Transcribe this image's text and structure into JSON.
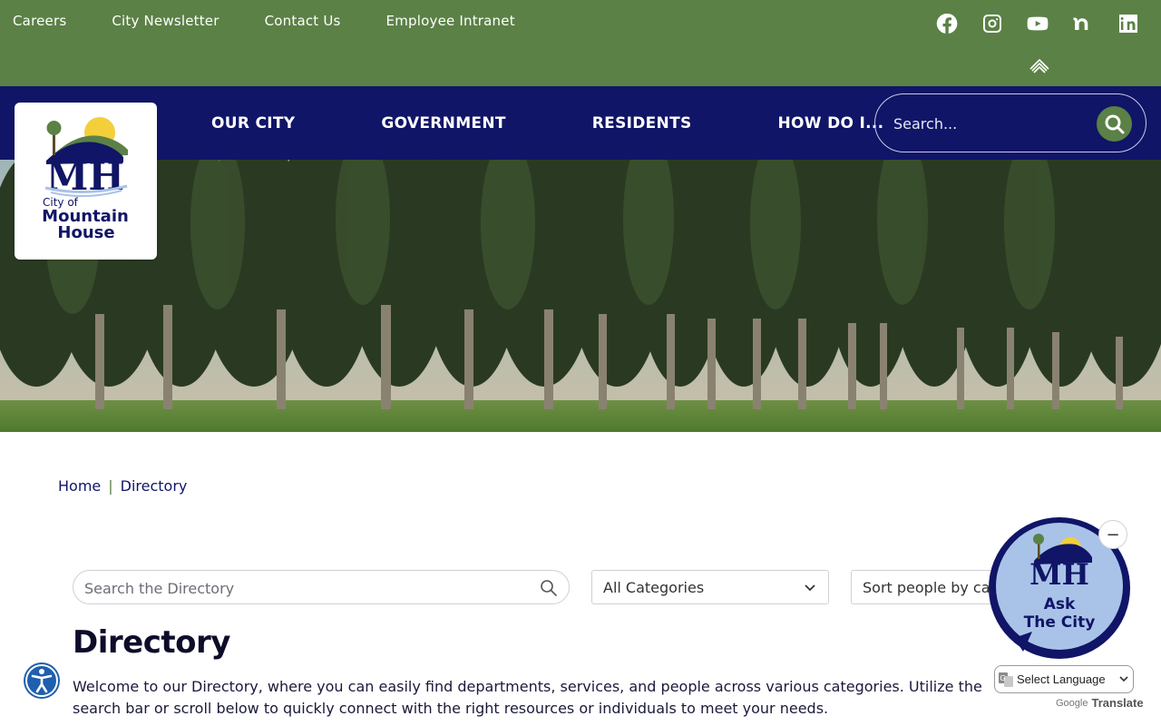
{
  "utility": {
    "links": [
      "Careers",
      "City Newsletter",
      "Contact Us",
      "Employee Intranet"
    ],
    "social_icons": [
      "facebook-icon",
      "instagram-icon",
      "youtube-icon",
      "nextdoor-icon",
      "linkedin-icon"
    ]
  },
  "logo": {
    "monogram": "MH",
    "line1": "City of",
    "line2": "Mountain",
    "line3": "House"
  },
  "nav": {
    "items": [
      "OUR CITY",
      "GOVERNMENT",
      "RESIDENTS",
      "HOW DO I..."
    ],
    "search_placeholder": "Search..."
  },
  "breadcrumb": {
    "home": "Home",
    "separator": "|",
    "current": "Directory"
  },
  "filters": {
    "search_placeholder": "Search the Directory",
    "category_selected": "All Categories",
    "sort_selected": "Sort people by category"
  },
  "page": {
    "title": "Directory",
    "intro": "Welcome to our Directory, where you can easily find departments, services, and people across various categories. Utilize the search bar or scroll below to quickly connect with the right resources or individuals to meet your needs."
  },
  "ask_widget": {
    "monogram": "MH",
    "line1": "Ask",
    "line2": "The City",
    "minimize": "−"
  },
  "translate": {
    "label": "Select Language",
    "powered_prefix": "Google",
    "powered_suffix": "Translate"
  },
  "colors": {
    "utility_green": "#5b8146",
    "nav_navy": "#101567",
    "widget_blue": "#a9c3e8"
  }
}
